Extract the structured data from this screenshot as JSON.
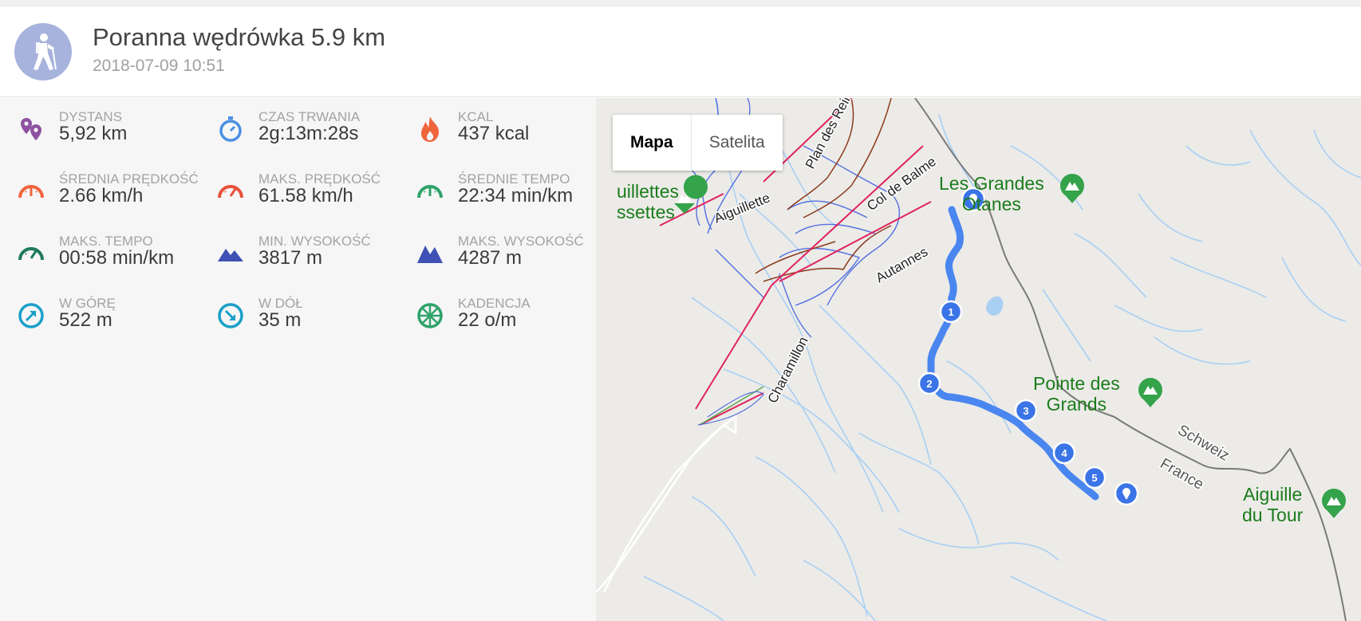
{
  "activity": {
    "title": "Poranna wędrówka 5.9 km",
    "datetime": "2018-07-09 10:51",
    "icon": "hiking-icon"
  },
  "stats": [
    {
      "label": "DYSTANS",
      "value": "5,92 km",
      "icon": "location-pins-icon",
      "color": "#8e52a1"
    },
    {
      "label": "CZAS TRWANIA",
      "value": "2g:13m:28s",
      "icon": "stopwatch-icon",
      "color": "#4a90e2"
    },
    {
      "label": "KCAL",
      "value": "437 kcal",
      "icon": "flame-icon",
      "color": "#f0643c"
    },
    {
      "label": "ŚREDNIA PRĘDKOŚĆ",
      "value": "2.66 km/h",
      "icon": "speedometer-icon",
      "color": "#f0643c"
    },
    {
      "label": "MAKS. PRĘDKOŚĆ",
      "value": "61.58 km/h",
      "icon": "speedometer-icon",
      "color": "#e8523b"
    },
    {
      "label": "ŚREDNIE TEMPO",
      "value": "22:34 min/km",
      "icon": "pace-gauge-icon",
      "color": "#2ea36a"
    },
    {
      "label": "MAKS. TEMPO",
      "value": "00:58 min/km",
      "icon": "pace-gauge-icon",
      "color": "#1f7a5a"
    },
    {
      "label": "MIN. WYSOKOŚĆ",
      "value": "3817 m",
      "icon": "mountain-icon",
      "color": "#3f51b5"
    },
    {
      "label": "MAKS. WYSOKOŚĆ",
      "value": "4287 m",
      "icon": "mountain-icon",
      "color": "#3f51b5"
    },
    {
      "label": "W GÓRĘ",
      "value": "522 m",
      "icon": "arrow-up-right-icon",
      "color": "#1aa0c8"
    },
    {
      "label": "W DÓŁ",
      "value": "35 m",
      "icon": "arrow-down-right-icon",
      "color": "#1aa0c8"
    },
    {
      "label": "KADENCJA",
      "value": "22 o/m",
      "icon": "wheel-icon",
      "color": "#2ea36a"
    }
  ],
  "map": {
    "tabs": {
      "map": "Mapa",
      "satellite": "Satelita"
    },
    "pois": [
      {
        "name": "uillettes\nssettes"
      },
      {
        "name": "Les Grandes\nOtanes"
      },
      {
        "name": "Pointe des\nGrands"
      },
      {
        "name": "Aiguille\ndu Tour"
      }
    ],
    "slope_labels": [
      "Plan des Rein",
      "Col de Balme",
      "Aiguillette",
      "Autannes",
      "Charamillon"
    ],
    "border_labels": [
      "Schweiz",
      "France"
    ],
    "km_markers": [
      "1",
      "2",
      "3",
      "4",
      "5"
    ],
    "route_color": "#4a86f0",
    "river_color": "#9fc8ef"
  }
}
